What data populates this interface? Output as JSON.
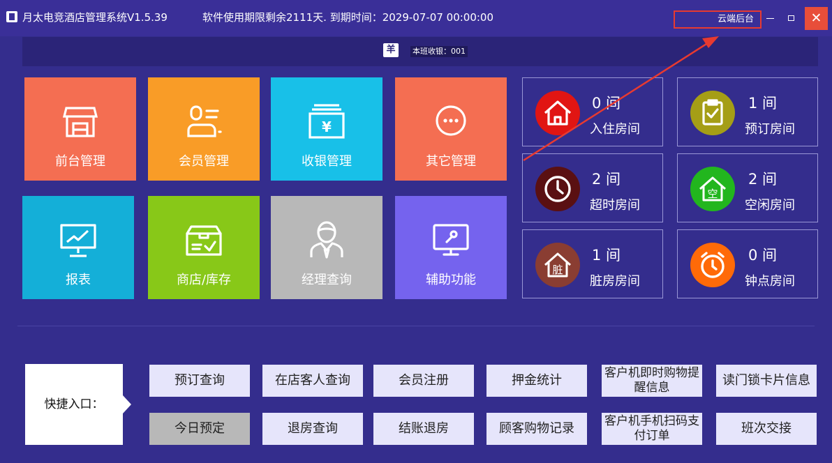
{
  "window": {
    "app_title": "月太电竞酒店管理系统V1.5.39",
    "license_text": "软件使用期限剩余2111天. 到期时间：2029-07-07 00:00:00",
    "cloud_backend_label": "云端后台",
    "close_symbol": "✕"
  },
  "shift": {
    "icon_glyph": "羊",
    "label": "本班收银：001"
  },
  "tiles": [
    {
      "label": "前台管理",
      "color": "#f46e52"
    },
    {
      "label": "会员管理",
      "color": "#f99c27"
    },
    {
      "label": "收银管理",
      "color": "#18c0e8"
    },
    {
      "label": "其它管理",
      "color": "#f46e52"
    },
    {
      "label": "报表",
      "color": "#14afd8"
    },
    {
      "label": "商店/库存",
      "color": "#88c818"
    },
    {
      "label": "经理查询",
      "color": "#b8b8b8"
    },
    {
      "label": "辅助功能",
      "color": "#7563ee"
    }
  ],
  "rooms": [
    {
      "count": "0 间",
      "label": "入住房间",
      "color": "#e11513",
      "icon": "house-icon"
    },
    {
      "count": "1 间",
      "label": "预订房间",
      "color": "#a59e16",
      "icon": "clipboard-check-icon"
    },
    {
      "count": "2 间",
      "label": "超时房间",
      "color": "#5a1012",
      "icon": "clock-icon"
    },
    {
      "count": "2 间",
      "label": "空闲房间",
      "color": "#22b61e",
      "icon": "empty-house-icon",
      "icon_text": "空"
    },
    {
      "count": "1 间",
      "label": "脏房房间",
      "color": "#8a3d32",
      "icon": "dirty-house-icon",
      "icon_text": "脏"
    },
    {
      "count": "0 间",
      "label": "钟点房间",
      "color": "#ff6a08",
      "icon": "alarm-clock-icon"
    }
  ],
  "quick_entry": {
    "label": "快捷入口：",
    "row1": [
      "预订查询",
      "在店客人查询",
      "会员注册",
      "押金统计",
      "客户机即时购物提醒信息",
      "读门锁卡片信息"
    ],
    "row2": [
      "今日预定",
      "退房查询",
      "结账退房",
      "顾客购物记录",
      "客户机手机扫码支付订单",
      "班次交接"
    ]
  }
}
